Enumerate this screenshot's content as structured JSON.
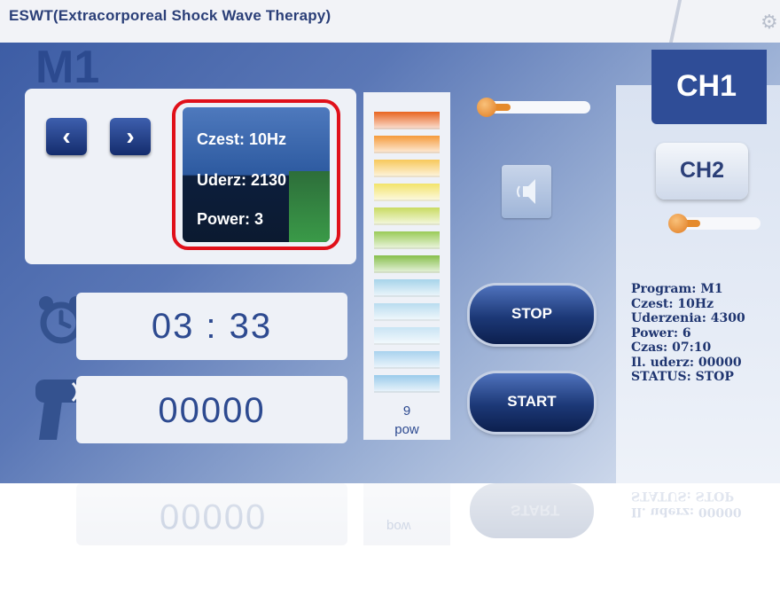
{
  "window": {
    "title": "ESWT(Extracorporeal Shock Wave Therapy)"
  },
  "channels": {
    "active": "CH1",
    "inactive": "CH2"
  },
  "program": {
    "name": "M1",
    "prev_icon": "chevron-left-icon",
    "next_icon": "chevron-right-icon"
  },
  "params": {
    "freq": "Czest: 10Hz",
    "hits": "Uderz: 2130",
    "power": "Power: 3"
  },
  "timer": {
    "value": "03 : 33",
    "icon": "alarm-clock-icon"
  },
  "counter": {
    "value": "00000",
    "icon": "shockwave-gun-icon"
  },
  "power_bar": {
    "value": "9",
    "label": "pow",
    "segments": [
      "#e8641f",
      "#f59a3a",
      "#f7c85a",
      "#f2e36a",
      "#c9db62",
      "#9acb58",
      "#86bf4c",
      "#a6d3ea",
      "#b9dcef",
      "#c9e4f4",
      "#a8d2ee",
      "#9acbeb"
    ]
  },
  "sliders": {
    "top_level": 0.15,
    "right_level": 0.15
  },
  "speaker": {
    "icon": "speaker-icon"
  },
  "buttons": {
    "stop": "STOP",
    "start": "START"
  },
  "status": {
    "program": "Program: M1",
    "freq": "Czest: 10Hz",
    "hits": "Uderzenia: 4300",
    "power": "Power: 6",
    "time": "Czas: 07:10",
    "count": "Il. uderz: 00000",
    "state": "STATUS: STOP"
  },
  "colors": {
    "accent": "#2f4d97",
    "highlight": "#e0101a",
    "slider": "#e58a2c"
  }
}
